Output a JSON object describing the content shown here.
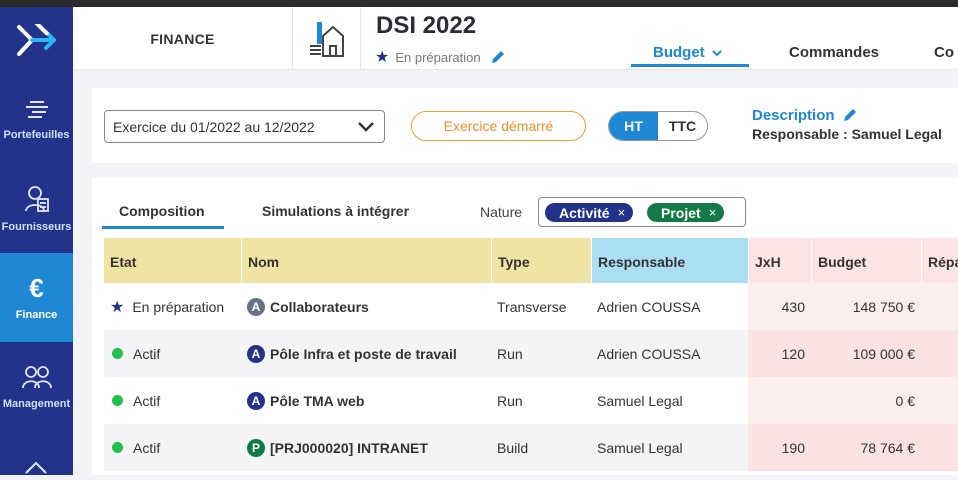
{
  "colors": {
    "sidebar": "#23338a",
    "accent": "#1e88d4",
    "warning": "#f0a030",
    "activite_chip": "#23338a",
    "projet_chip": "#137a47"
  },
  "sidebar": {
    "items": [
      {
        "label": "Portefeuilles",
        "icon": "portfolio-icon"
      },
      {
        "label": "Fournisseurs",
        "icon": "supplier-icon"
      },
      {
        "label": "Finance",
        "icon": "euro-icon",
        "active": true
      },
      {
        "label": "Management",
        "icon": "team-icon"
      }
    ]
  },
  "header": {
    "module": "FINANCE",
    "title": "DSI 2022",
    "status": "En préparation",
    "tabs": [
      {
        "label": "Budget",
        "active": true
      },
      {
        "label": "Commandes"
      },
      {
        "label": "Co"
      }
    ]
  },
  "filters": {
    "period": "Exercice du 01/2022 au 12/2022",
    "exercise_status": "Exercice démarré",
    "toggle": {
      "ht": "HT",
      "ttc": "TTC",
      "selected": "HT"
    },
    "description_link": "Description",
    "owner": "Responsable : Samuel Legal"
  },
  "card": {
    "tabs": [
      {
        "label": "Composition",
        "active": true
      },
      {
        "label": "Simulations à intégrer"
      }
    ],
    "nature_label": "Nature",
    "chips": [
      {
        "label": "Activité",
        "close": "×"
      },
      {
        "label": "Projet",
        "close": "×"
      }
    ]
  },
  "table": {
    "columns": [
      "Etat",
      "Nom",
      "Type",
      "Responsable",
      "JxH",
      "Budget",
      "Répa"
    ],
    "rows": [
      {
        "etat": "En préparation",
        "etat_icon": "star",
        "badge": "A",
        "badge_color": "#6b7086",
        "nom": "Collaborateurs",
        "type": "Transverse",
        "responsable": "Adrien COUSSA",
        "jxh": "430",
        "budget": "148 750 €"
      },
      {
        "etat": "Actif",
        "etat_icon": "dot",
        "badge": "A",
        "badge_color": "#23338a",
        "nom": "Pôle Infra et poste de travail",
        "type": "Run",
        "responsable": "Adrien COUSSA",
        "jxh": "120",
        "budget": "109 000 €"
      },
      {
        "etat": "Actif",
        "etat_icon": "dot",
        "badge": "A",
        "badge_color": "#23338a",
        "nom": "Pôle TMA web",
        "type": "Run",
        "responsable": "Samuel Legal",
        "jxh": "",
        "budget": "0 €"
      },
      {
        "etat": "Actif",
        "etat_icon": "dot",
        "badge": "P",
        "badge_color": "#137a47",
        "nom": "[PRJ000020] INTRANET",
        "type": "Build",
        "responsable": "Samuel Legal",
        "jxh": "190",
        "budget": "78 764 €"
      }
    ]
  }
}
